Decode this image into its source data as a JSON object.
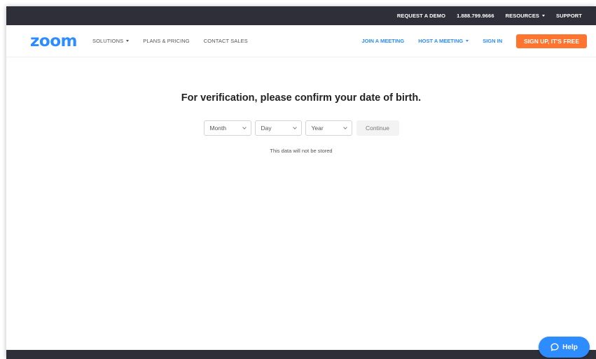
{
  "utility_bar": {
    "request_demo": "REQUEST A DEMO",
    "phone": "1.888.799.9666",
    "resources": "RESOURCES",
    "support": "SUPPORT"
  },
  "navbar": {
    "logo": "zoom",
    "solutions": "SOLUTIONS",
    "plans_pricing": "PLANS & PRICING",
    "contact_sales": "CONTACT SALES",
    "join_meeting": "JOIN A MEETING",
    "host_meeting": "HOST A MEETING",
    "sign_in": "SIGN IN",
    "sign_up": "SIGN UP, IT'S FREE"
  },
  "verification": {
    "heading": "For verification, please confirm your date of birth.",
    "month_placeholder": "Month",
    "day_placeholder": "Day",
    "year_placeholder": "Year",
    "continue_label": "Continue",
    "note": "This data will not be stored"
  },
  "help": {
    "label": "Help"
  },
  "colors": {
    "brand_blue": "#2d8cff",
    "signup_orange": "#ff742e",
    "dark_bar": "#2f2f3a"
  },
  "icons": {
    "dropdown": "caret-down-icon",
    "select": "chevron-down-icon",
    "help": "chat-bubble-icon"
  }
}
